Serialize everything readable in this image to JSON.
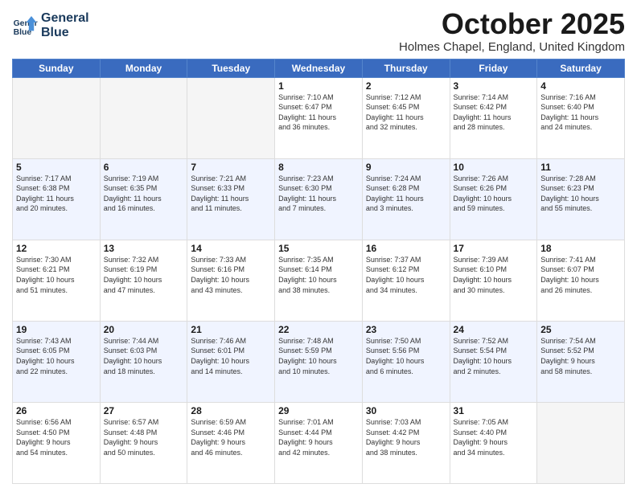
{
  "logo": {
    "line1": "General",
    "line2": "Blue"
  },
  "title": "October 2025",
  "location": "Holmes Chapel, England, United Kingdom",
  "days_of_week": [
    "Sunday",
    "Monday",
    "Tuesday",
    "Wednesday",
    "Thursday",
    "Friday",
    "Saturday"
  ],
  "weeks": [
    [
      {
        "day": "",
        "info": ""
      },
      {
        "day": "",
        "info": ""
      },
      {
        "day": "",
        "info": ""
      },
      {
        "day": "1",
        "info": "Sunrise: 7:10 AM\nSunset: 6:47 PM\nDaylight: 11 hours\nand 36 minutes."
      },
      {
        "day": "2",
        "info": "Sunrise: 7:12 AM\nSunset: 6:45 PM\nDaylight: 11 hours\nand 32 minutes."
      },
      {
        "day": "3",
        "info": "Sunrise: 7:14 AM\nSunset: 6:42 PM\nDaylight: 11 hours\nand 28 minutes."
      },
      {
        "day": "4",
        "info": "Sunrise: 7:16 AM\nSunset: 6:40 PM\nDaylight: 11 hours\nand 24 minutes."
      }
    ],
    [
      {
        "day": "5",
        "info": "Sunrise: 7:17 AM\nSunset: 6:38 PM\nDaylight: 11 hours\nand 20 minutes."
      },
      {
        "day": "6",
        "info": "Sunrise: 7:19 AM\nSunset: 6:35 PM\nDaylight: 11 hours\nand 16 minutes."
      },
      {
        "day": "7",
        "info": "Sunrise: 7:21 AM\nSunset: 6:33 PM\nDaylight: 11 hours\nand 11 minutes."
      },
      {
        "day": "8",
        "info": "Sunrise: 7:23 AM\nSunset: 6:30 PM\nDaylight: 11 hours\nand 7 minutes."
      },
      {
        "day": "9",
        "info": "Sunrise: 7:24 AM\nSunset: 6:28 PM\nDaylight: 11 hours\nand 3 minutes."
      },
      {
        "day": "10",
        "info": "Sunrise: 7:26 AM\nSunset: 6:26 PM\nDaylight: 10 hours\nand 59 minutes."
      },
      {
        "day": "11",
        "info": "Sunrise: 7:28 AM\nSunset: 6:23 PM\nDaylight: 10 hours\nand 55 minutes."
      }
    ],
    [
      {
        "day": "12",
        "info": "Sunrise: 7:30 AM\nSunset: 6:21 PM\nDaylight: 10 hours\nand 51 minutes."
      },
      {
        "day": "13",
        "info": "Sunrise: 7:32 AM\nSunset: 6:19 PM\nDaylight: 10 hours\nand 47 minutes."
      },
      {
        "day": "14",
        "info": "Sunrise: 7:33 AM\nSunset: 6:16 PM\nDaylight: 10 hours\nand 43 minutes."
      },
      {
        "day": "15",
        "info": "Sunrise: 7:35 AM\nSunset: 6:14 PM\nDaylight: 10 hours\nand 38 minutes."
      },
      {
        "day": "16",
        "info": "Sunrise: 7:37 AM\nSunset: 6:12 PM\nDaylight: 10 hours\nand 34 minutes."
      },
      {
        "day": "17",
        "info": "Sunrise: 7:39 AM\nSunset: 6:10 PM\nDaylight: 10 hours\nand 30 minutes."
      },
      {
        "day": "18",
        "info": "Sunrise: 7:41 AM\nSunset: 6:07 PM\nDaylight: 10 hours\nand 26 minutes."
      }
    ],
    [
      {
        "day": "19",
        "info": "Sunrise: 7:43 AM\nSunset: 6:05 PM\nDaylight: 10 hours\nand 22 minutes."
      },
      {
        "day": "20",
        "info": "Sunrise: 7:44 AM\nSunset: 6:03 PM\nDaylight: 10 hours\nand 18 minutes."
      },
      {
        "day": "21",
        "info": "Sunrise: 7:46 AM\nSunset: 6:01 PM\nDaylight: 10 hours\nand 14 minutes."
      },
      {
        "day": "22",
        "info": "Sunrise: 7:48 AM\nSunset: 5:59 PM\nDaylight: 10 hours\nand 10 minutes."
      },
      {
        "day": "23",
        "info": "Sunrise: 7:50 AM\nSunset: 5:56 PM\nDaylight: 10 hours\nand 6 minutes."
      },
      {
        "day": "24",
        "info": "Sunrise: 7:52 AM\nSunset: 5:54 PM\nDaylight: 10 hours\nand 2 minutes."
      },
      {
        "day": "25",
        "info": "Sunrise: 7:54 AM\nSunset: 5:52 PM\nDaylight: 9 hours\nand 58 minutes."
      }
    ],
    [
      {
        "day": "26",
        "info": "Sunrise: 6:56 AM\nSunset: 4:50 PM\nDaylight: 9 hours\nand 54 minutes."
      },
      {
        "day": "27",
        "info": "Sunrise: 6:57 AM\nSunset: 4:48 PM\nDaylight: 9 hours\nand 50 minutes."
      },
      {
        "day": "28",
        "info": "Sunrise: 6:59 AM\nSunset: 4:46 PM\nDaylight: 9 hours\nand 46 minutes."
      },
      {
        "day": "29",
        "info": "Sunrise: 7:01 AM\nSunset: 4:44 PM\nDaylight: 9 hours\nand 42 minutes."
      },
      {
        "day": "30",
        "info": "Sunrise: 7:03 AM\nSunset: 4:42 PM\nDaylight: 9 hours\nand 38 minutes."
      },
      {
        "day": "31",
        "info": "Sunrise: 7:05 AM\nSunset: 4:40 PM\nDaylight: 9 hours\nand 34 minutes."
      },
      {
        "day": "",
        "info": ""
      }
    ]
  ]
}
